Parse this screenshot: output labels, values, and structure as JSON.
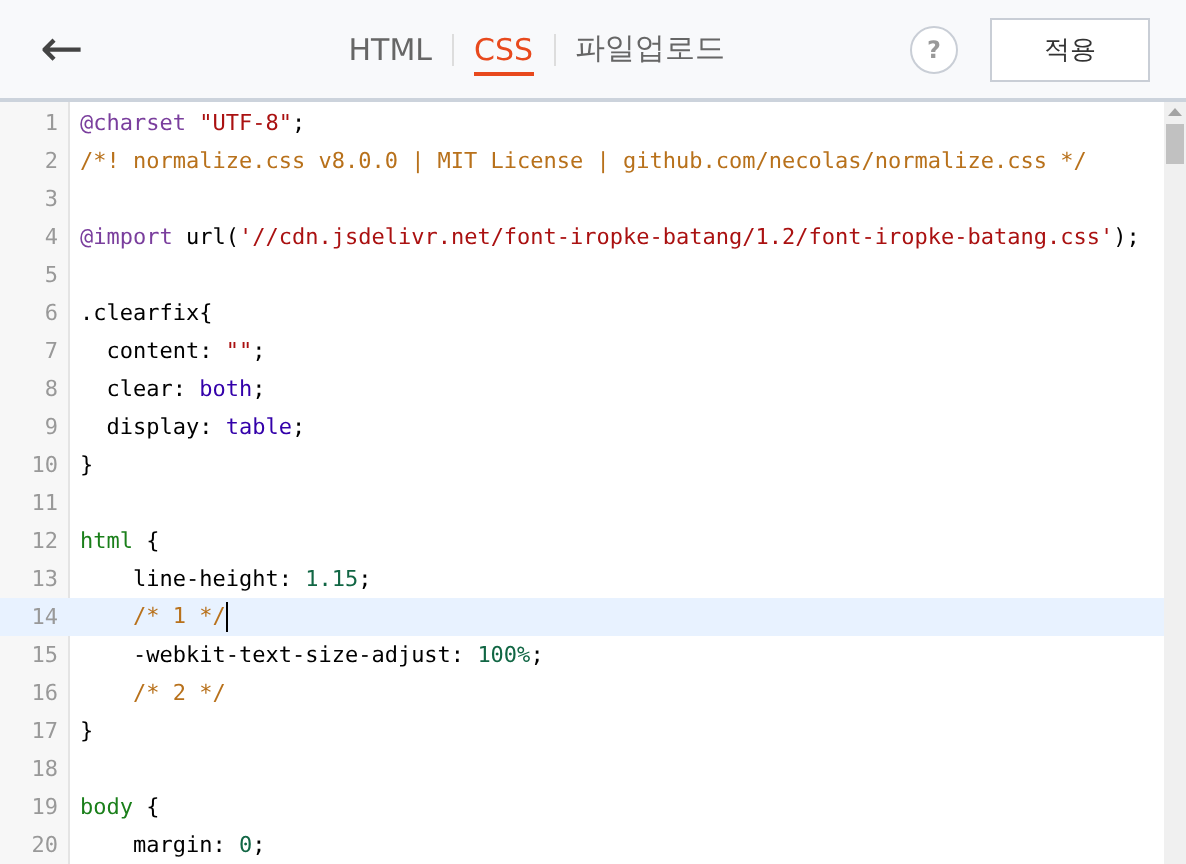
{
  "header": {
    "back": "←",
    "tabs": [
      {
        "label": "HTML",
        "selected": false
      },
      {
        "label": "CSS",
        "selected": true
      },
      {
        "label": "파일업로드",
        "selected": false
      }
    ],
    "help": "?",
    "apply": "적용"
  },
  "editor": {
    "lines": [
      {
        "number": "1",
        "active": false,
        "tokens": [
          {
            "kind": "at",
            "text": "@charset"
          },
          {
            "kind": "string",
            "text": " \"UTF-8\""
          },
          {
            "kind": "plain",
            "text": ";"
          }
        ]
      },
      {
        "number": "2",
        "active": false,
        "tokens": [
          {
            "kind": "comment",
            "text": "/*! normalize.css v8.0.0 | MIT License | github.com/necolas/normalize.css */"
          }
        ]
      },
      {
        "number": "3",
        "active": false
      },
      {
        "number": "4",
        "active": false,
        "tokens": [
          {
            "kind": "at",
            "text": "@import"
          },
          {
            "kind": "plain",
            "text": " url("
          },
          {
            "kind": "string",
            "text": "'//cdn.jsdelivr.net/font-iropke-batang/1.2/font-iropke-batang.css'"
          },
          {
            "kind": "plain",
            "text": ");"
          }
        ]
      },
      {
        "number": "5",
        "active": false
      },
      {
        "number": "6",
        "active": false,
        "tokens": [
          {
            "kind": "plain",
            "text": ".clearfix{"
          }
        ]
      },
      {
        "number": "7",
        "active": false,
        "tokens": [
          {
            "kind": "plain",
            "text": "  content: "
          },
          {
            "kind": "string",
            "text": "\"\""
          },
          {
            "kind": "plain",
            "text": ";"
          }
        ]
      },
      {
        "number": "8",
        "active": false,
        "tokens": [
          {
            "kind": "plain",
            "text": "  clear: "
          },
          {
            "kind": "atom",
            "text": "both"
          },
          {
            "kind": "plain",
            "text": ";"
          }
        ]
      },
      {
        "number": "9",
        "active": false,
        "tokens": [
          {
            "kind": "plain",
            "text": "  display: "
          },
          {
            "kind": "atom",
            "text": "table"
          },
          {
            "kind": "plain",
            "text": ";"
          }
        ]
      },
      {
        "number": "10",
        "active": false,
        "tokens": [
          {
            "kind": "plain",
            "text": "}"
          }
        ]
      },
      {
        "number": "11",
        "active": false
      },
      {
        "number": "12",
        "active": false,
        "tokens": [
          {
            "kind": "tag",
            "text": "html"
          },
          {
            "kind": "plain",
            "text": " {"
          }
        ]
      },
      {
        "number": "13",
        "active": false,
        "tokens": [
          {
            "kind": "plain",
            "text": "    line-height: "
          },
          {
            "kind": "number",
            "text": "1.15"
          },
          {
            "kind": "plain",
            "text": ";"
          }
        ]
      },
      {
        "number": "14",
        "active": true,
        "tokens": [
          {
            "kind": "comment",
            "text": "    /* 1 */"
          }
        ]
      },
      {
        "number": "15",
        "active": false,
        "tokens": [
          {
            "kind": "plain",
            "text": "    -webkit-text-size-adjust: "
          },
          {
            "kind": "number",
            "text": "100%"
          },
          {
            "kind": "plain",
            "text": ";"
          }
        ]
      },
      {
        "number": "16",
        "active": false,
        "tokens": [
          {
            "kind": "comment",
            "text": "    /* 2 */"
          }
        ]
      },
      {
        "number": "17",
        "active": false,
        "tokens": [
          {
            "kind": "plain",
            "text": "}"
          }
        ]
      },
      {
        "number": "18",
        "active": false
      },
      {
        "number": "19",
        "active": false,
        "tokens": [
          {
            "kind": "tag",
            "text": "body"
          },
          {
            "kind": "plain",
            "text": " {"
          }
        ]
      },
      {
        "number": "20",
        "active": false,
        "tokens": [
          {
            "kind": "plain",
            "text": "    margin: "
          },
          {
            "kind": "number",
            "text": "0"
          },
          {
            "kind": "plain",
            "text": ";"
          }
        ]
      }
    ]
  }
}
